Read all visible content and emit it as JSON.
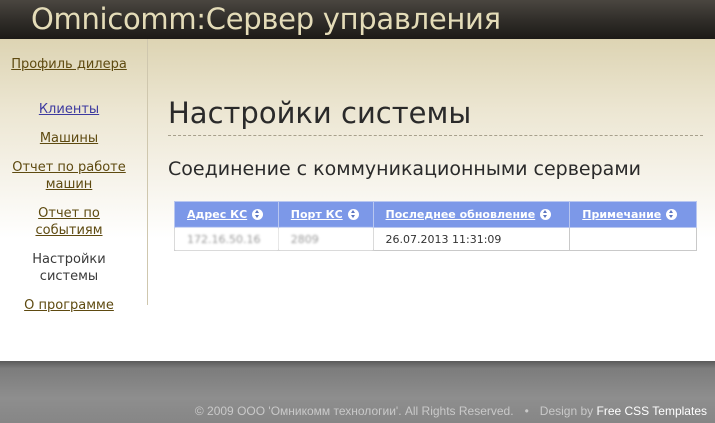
{
  "header": {
    "brand": "Omnicomm:Сервер управления"
  },
  "sidebar": {
    "items": [
      {
        "label": "Профиль дилера"
      },
      {
        "label": "Клиенты"
      },
      {
        "label": "Машины"
      },
      {
        "label": "Отчет по работе машин"
      },
      {
        "label": "Отчет по событиям"
      },
      {
        "label": "Настройки системы"
      },
      {
        "label": "О программе"
      }
    ]
  },
  "main": {
    "title": "Настройки системы",
    "section_title": "Соединение с коммуникационными серверами",
    "table": {
      "columns": [
        "Адрес КС",
        "Порт КС",
        "Последнее обновление",
        "Примечание"
      ],
      "rows": [
        [
          "172.16.50.16",
          "2809",
          "26.07.2013 11:31:09",
          ""
        ]
      ]
    }
  },
  "footer": {
    "copyright": "© 2009 ООО 'Омникомм технологии'. All Rights Reserved.",
    "separator": "•",
    "design_by": "Design by",
    "design_link": "Free CSS Templates"
  }
}
